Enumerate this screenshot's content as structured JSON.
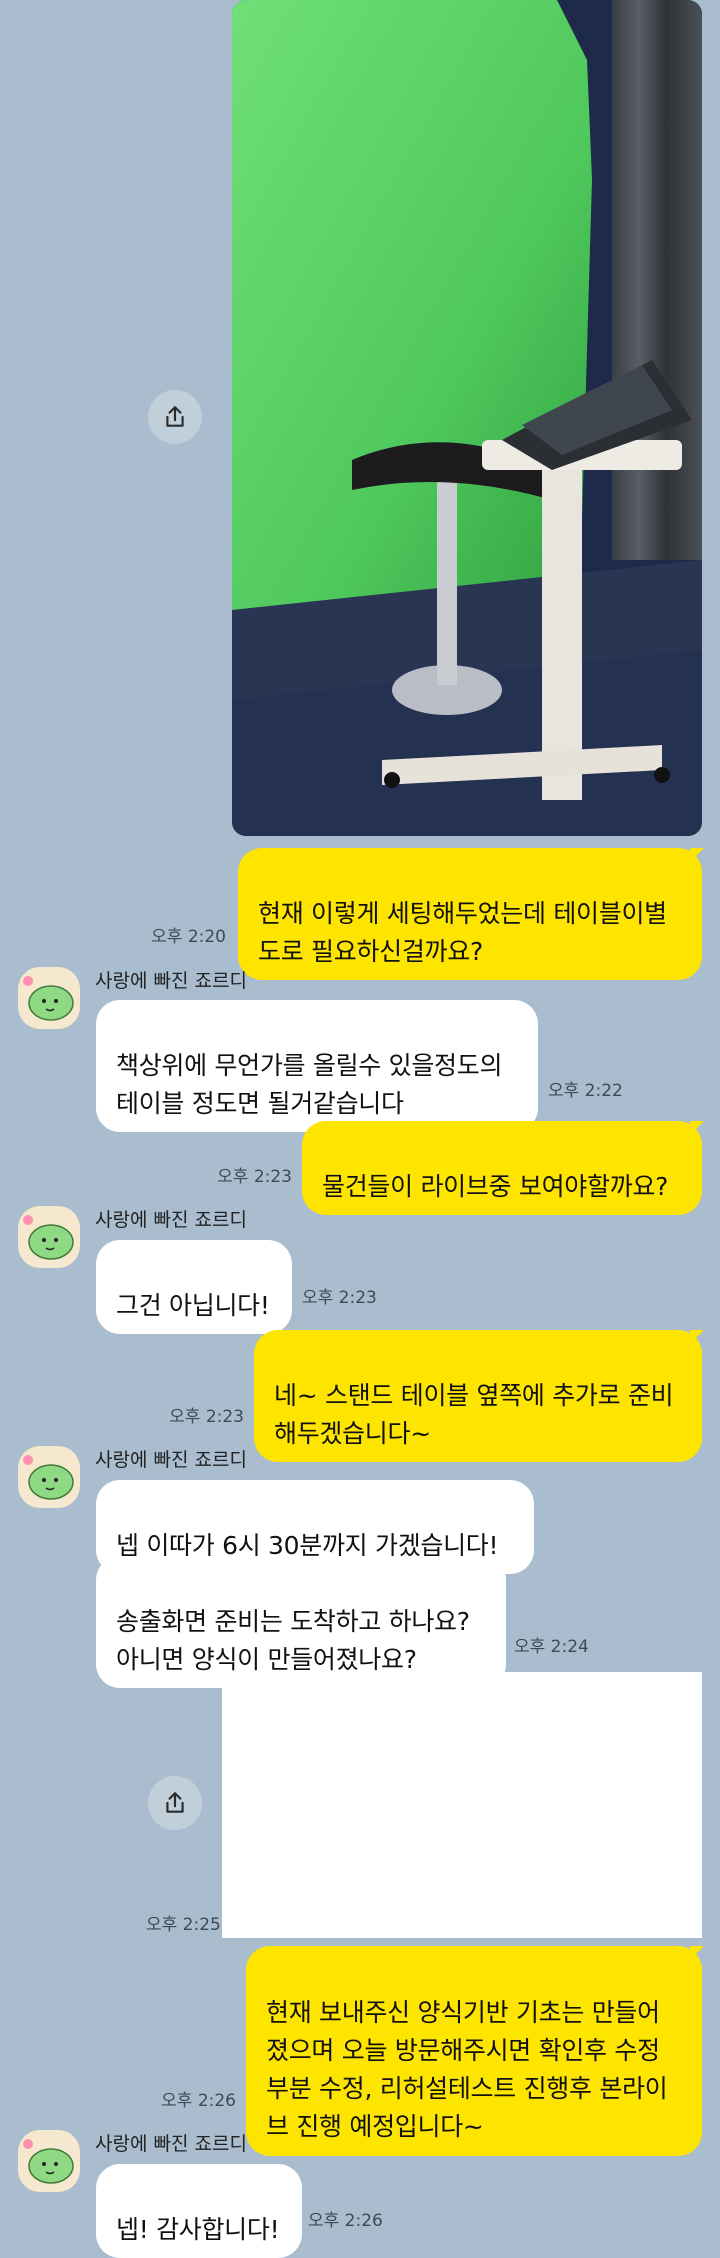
{
  "chat": {
    "messages": {
      "m1": {
        "text": "현재 이렇게 세팅해두었는데 테이블이별도로 필요하신걸까요?",
        "time": "오후 2:20"
      },
      "m2": {
        "sender": "사랑에 빠진 죠르디",
        "text": "책상위에 무언가를 올릴수 있을정도의\n테이블 정도면 될거같습니다",
        "time": "오후 2:22"
      },
      "m3": {
        "text": "물건들이 라이브중 보여야할까요?",
        "time": "오후 2:23"
      },
      "m4": {
        "sender": "사랑에 빠진 죠르디",
        "text": "그건 아닙니다!",
        "time": "오후 2:23"
      },
      "m5": {
        "text": "네~ 스탠드 테이블 옆쪽에 추가로 준비해두겠습니다~",
        "time": "오후 2:23"
      },
      "m6": {
        "sender": "사랑에 빠진 죠르디",
        "text": "넵 이따가 6시 30분까지 가겠습니다!",
        "time": ""
      },
      "m7": {
        "text": "송출화면 준비는 도착하고 하나요?\n아니면 양식이 만들어졌나요?",
        "time": "오후 2:24"
      },
      "m8": {
        "time": "오후 2:25"
      },
      "m9": {
        "text": "현재 보내주신 양식기반 기초는 만들어졌으며 오늘 방문해주시면 확인후 수정부분 수정, 리허설테스트 진행후 본라이브 진행 예정입니다~",
        "time": "오후 2:26"
      },
      "m10": {
        "sender": "사랑에 빠진 죠르디",
        "text": "넵! 감사합니다!",
        "time": "오후 2:26"
      }
    }
  },
  "icons": {
    "share": "share-icon",
    "avatar": "jordy-avatar-icon"
  },
  "colors": {
    "background": "#a9bdce",
    "my_bubble": "#fee500",
    "other_bubble": "#ffffff"
  }
}
